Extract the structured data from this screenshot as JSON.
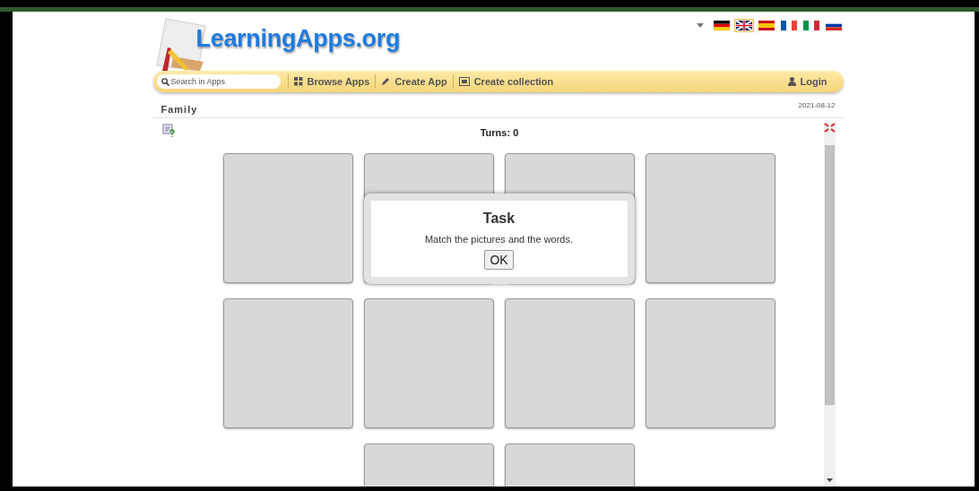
{
  "languages": [
    {
      "kind": "de",
      "selected": false
    },
    {
      "kind": "en",
      "selected": true
    },
    {
      "kind": "es",
      "selected": false
    },
    {
      "kind": "fr",
      "selected": false
    },
    {
      "kind": "it",
      "selected": false
    },
    {
      "kind": "ru",
      "selected": false
    }
  ],
  "logo": {
    "text": "LearningApps.org"
  },
  "nav": {
    "search": {
      "placeholder": "Search in Apps"
    },
    "items": [
      {
        "label": "Browse Apps",
        "kind": "grid"
      },
      {
        "label": "Create App",
        "kind": "pencil"
      },
      {
        "label": "Create collection",
        "kind": "collection"
      }
    ],
    "login": "Login"
  },
  "app": {
    "title": "Family",
    "date": "2021-08-12",
    "turns": "Turns: 0"
  },
  "cards": [
    {
      "revealed": false
    },
    {
      "revealed": false
    },
    {
      "revealed": false
    },
    {
      "revealed": false
    },
    {
      "revealed": false
    },
    {
      "revealed": false
    },
    {
      "revealed": false
    },
    {
      "revealed": false
    },
    {
      "revealed": false
    },
    {
      "revealed": false
    }
  ],
  "dialog": {
    "title": "Task",
    "message": "Match the pictures and the words.",
    "button": "OK"
  }
}
